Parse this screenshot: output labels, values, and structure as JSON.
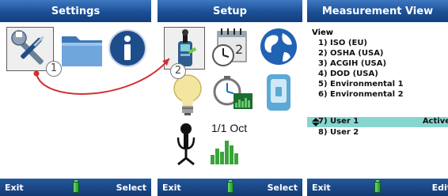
{
  "panels": [
    {
      "title": "Settings",
      "left_softkey": "Exit",
      "right_softkey": "Select"
    },
    {
      "title": "Setup",
      "left_softkey": "Exit",
      "right_softkey": "Select"
    },
    {
      "title": "Measurement View",
      "left_softkey": "Exit",
      "right_softkey": "Edit"
    }
  ],
  "steps": [
    "1",
    "2"
  ],
  "setup": {
    "octave_label": "1/1 Oct"
  },
  "measurement_view": {
    "heading": "View",
    "items": [
      "1) ISO (EU)",
      "2) OSHA (USA)",
      "3) ACGIH (USA)",
      "4) DOD (USA)",
      "5) Environmental 1",
      "6) Environmental 2",
      "7) User 1",
      "8) User 2"
    ],
    "selected_status": "Active"
  },
  "icons": {
    "settings": [
      "tools-icon",
      "folder-icon",
      "info-icon"
    ],
    "setup": [
      "sound-level-meter-icon",
      "calendar-clock-icon",
      "globe-icon",
      "light-bulb-icon",
      "timer-chart-icon",
      "device-icon",
      "microphone-icon",
      "octave-bars-icon"
    ]
  },
  "colors": {
    "title_bar": "#1b4f96",
    "highlight": "#86d6cf",
    "arrow": "#d32f2f",
    "battery": "#1f9a2b"
  }
}
